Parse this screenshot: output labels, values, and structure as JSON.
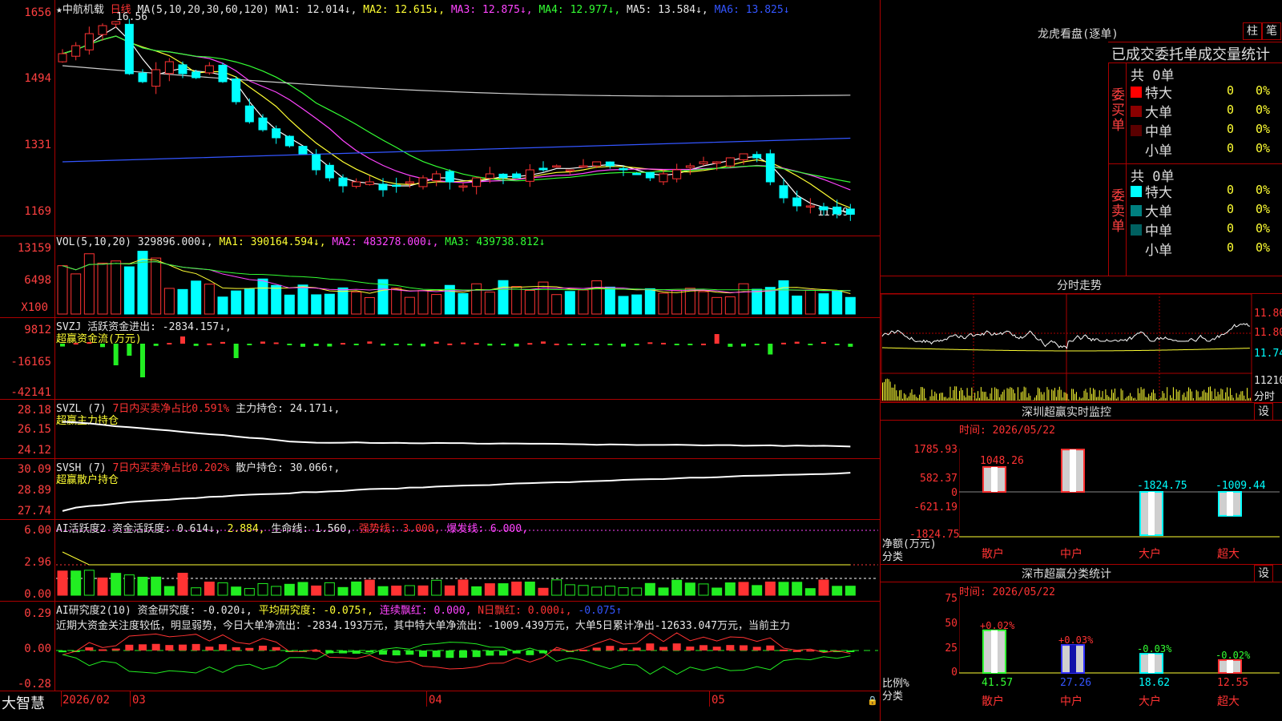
{
  "main": {
    "stock_name": "★中航机载",
    "period": "日线",
    "ma_label": "MA(5,10,20,30,60,120)",
    "ma1": "MA1: 12.014↓,",
    "ma2": "MA2: 12.615↓,",
    "ma3": "MA3: 12.875↓,",
    "ma4": "MA4: 12.977↓,",
    "ma5": "MA5: 13.584↓,",
    "ma6": "MA6: 13.825↓",
    "y_ticks": [
      "1656",
      "1494",
      "1331",
      "1169"
    ],
    "high_label": "16.56",
    "low_label": "11.69"
  },
  "vol": {
    "label": "VOL(5,10,20)",
    "v": "329896.000↓,",
    "ma1": "MA1: 390164.594↓,",
    "ma2": "MA2: 483278.000↓,",
    "ma3": "MA3: 439738.812↓",
    "y_ticks": [
      "13159",
      "6498",
      "X100"
    ]
  },
  "svzj": {
    "title": "SVZJ  活跃资金进出: -2834.157↓,",
    "sub": "超赢资金流(万元)",
    "y_ticks": [
      "9812",
      "-16165",
      "-42141"
    ]
  },
  "svzl": {
    "l1": "SVZL (7)",
    "l2": "7日内买卖净占比0.591%",
    "l3": "主力持仓: 24.171↓,",
    "sub": "超赢主力持仓",
    "y_ticks": [
      "28.18",
      "26.15",
      "24.12"
    ]
  },
  "svsh": {
    "l1": "SVSH (7)",
    "l2": "7日内买卖净占比0.202%",
    "l3": "散户持仓: 30.066↑,",
    "sub": "超赢散户持仓",
    "y_ticks": [
      "30.09",
      "28.89",
      "27.74"
    ]
  },
  "ai1": {
    "l1": "AI活跃度2 资金活跃度: 0.614↓,",
    "l2": "2.884,",
    "l3": "生命线: 1.560,",
    "l4": "强势线: 3.000,",
    "l5": "爆发线: 6.000,",
    "y_ticks": [
      "6.00",
      "2.96",
      "0.00"
    ]
  },
  "ai2": {
    "l1": "AI研究度2(10) 资金研究度: -0.020↓,",
    "l2": "平均研究度: -0.075↑,",
    "l3": "连续飘红: 0.000,",
    "l4": "N日飘红: 0.000↓,",
    "l5": "-0.075↑",
    "text": "近期大资金关注度较低，明显弱势，今日大单净流出：-2834.193万元，其中特大单净流出：-1009.439万元，大单5日累计净出-12633.047万元，当前主力",
    "y_ticks": [
      "0.29",
      "0.00",
      "-0.28"
    ]
  },
  "footer": {
    "brand": "大智慧",
    "dates": [
      "2026/02",
      "03",
      "04",
      "05"
    ]
  },
  "dragon": {
    "title": "龙虎看盘(逐单)",
    "btn1": "柱",
    "btn2": "笔",
    "subtitle": "已成交委托单成交量统计",
    "buy_label": "委买单",
    "sell_label": "委卖单",
    "buy_total": "共 0单",
    "sell_total": "共 0单",
    "buy_rows": [
      {
        "name": "特大",
        "count": "0",
        "pct": "0%",
        "color": "#ff0000"
      },
      {
        "name": "大单",
        "count": "0",
        "pct": "0%",
        "color": "#8b0000"
      },
      {
        "name": "中单",
        "count": "0",
        "pct": "0%",
        "color": "#5a0000"
      },
      {
        "name": "小单",
        "count": "0",
        "pct": "0%",
        "color": "#000000"
      }
    ],
    "sell_rows": [
      {
        "name": "特大",
        "count": "0",
        "pct": "0%",
        "color": "#00ffff"
      },
      {
        "name": "大单",
        "count": "0",
        "pct": "0%",
        "color": "#008080"
      },
      {
        "name": "中单",
        "count": "0",
        "pct": "0%",
        "color": "#006060"
      },
      {
        "name": "小单",
        "count": "0",
        "pct": "0%",
        "color": "#000000"
      }
    ]
  },
  "intraday": {
    "title": "分时走势",
    "p1": "11.86",
    "p2": "11.80",
    "p3": "11.74",
    "vol": "11210",
    "vol_label": "分时"
  },
  "sz_monitor": {
    "title": "深圳超赢实时监控",
    "btn": "设",
    "date": "时间: 2026/05/22",
    "y_ticks": [
      "1785.93",
      "582.37",
      "0",
      "-621.19",
      "-1824.75"
    ],
    "ylabel1": "净额(万元)",
    "ylabel2": "分类",
    "categories": [
      "散户",
      "中户",
      "大户",
      "超大"
    ],
    "values": [
      "1048.26",
      "1785.93",
      "-1824.75",
      "-1009.44"
    ]
  },
  "sz_class": {
    "title": "深市超赢分类统计",
    "btn": "设",
    "date": "时间: 2026/05/22",
    "y_ticks": [
      "75",
      "50",
      "25",
      "0"
    ],
    "ylabel1": "比例%",
    "ylabel2": "分类",
    "categories": [
      "散户",
      "中户",
      "大户",
      "超大"
    ],
    "values": [
      "41.57",
      "27.26",
      "18.62",
      "12.55"
    ],
    "deltas": [
      "+0.02%",
      "+0.03%",
      "-0.03%",
      "-0.02%"
    ]
  },
  "colors": {
    "up": "#ff3333",
    "down": "#00ffff",
    "grid": "#aa0000"
  }
}
